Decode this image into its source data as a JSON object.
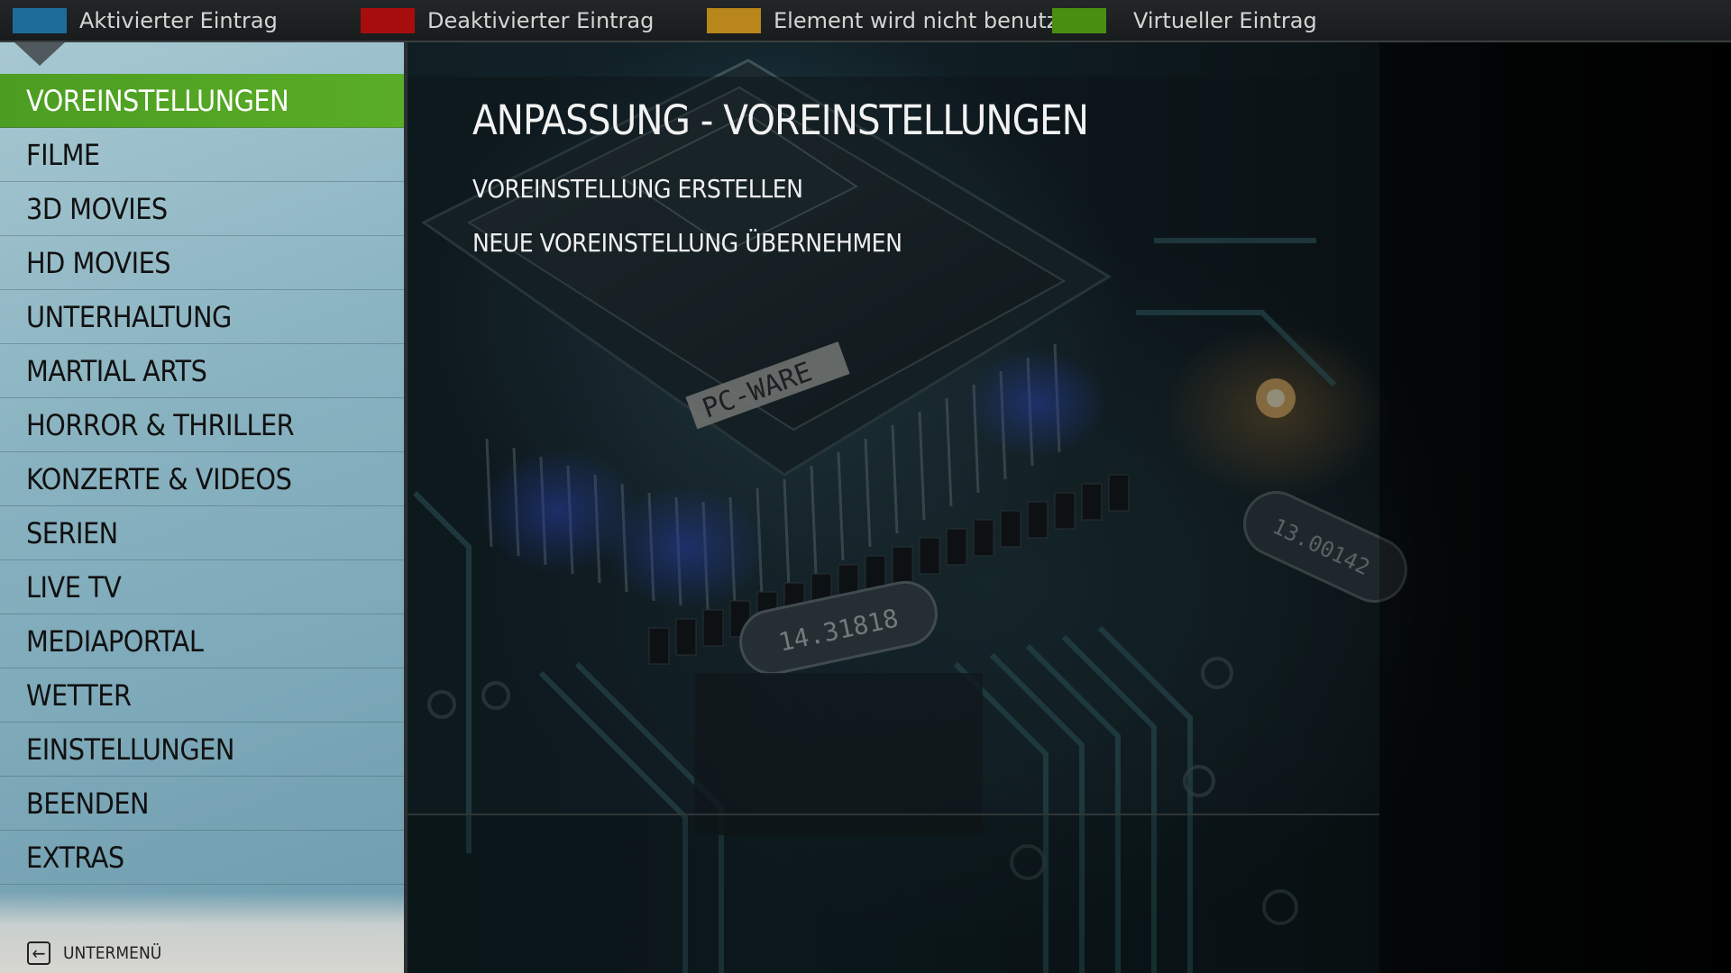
{
  "legend": [
    {
      "label": "Aktivierter Eintrag",
      "color": "#1d6d9b"
    },
    {
      "label": "Deaktivierter Eintrag",
      "color": "#a80d0d"
    },
    {
      "label": "Element wird nicht benutzt",
      "color": "#b8861a"
    },
    {
      "label": "Virtueller Eintrag",
      "color": "#4a8f12"
    }
  ],
  "sidebar": {
    "items": [
      {
        "label": "VOREINSTELLUNGEN",
        "active": true
      },
      {
        "label": "FILME"
      },
      {
        "label": "3D MOVIES"
      },
      {
        "label": "HD MOVIES"
      },
      {
        "label": "UNTERHALTUNG"
      },
      {
        "label": "MARTIAL ARTS"
      },
      {
        "label": "HORROR & THRILLER"
      },
      {
        "label": "KONZERTE & VIDEOS"
      },
      {
        "label": "SERIEN"
      },
      {
        "label": "LIVE TV"
      },
      {
        "label": "MEDIAPORTAL"
      },
      {
        "label": "WETTER"
      },
      {
        "label": "EINSTELLUNGEN"
      },
      {
        "label": "BEENDEN"
      },
      {
        "label": "EXTRAS"
      }
    ],
    "submenu_label": "UNTERMENÜ",
    "submenu_icon": "arrow-left-icon"
  },
  "content": {
    "title": "ANPASSUNG - VOREINSTELLUNGEN",
    "options": [
      "VOREINSTELLUNG ERSTELLEN",
      "NEUE VOREINSTELLUNG ÜBERNEHMEN"
    ]
  },
  "background": {
    "chip_label": "PC-WARE",
    "crystal_label": "14.31818",
    "crystal2_label": "13.00142"
  }
}
